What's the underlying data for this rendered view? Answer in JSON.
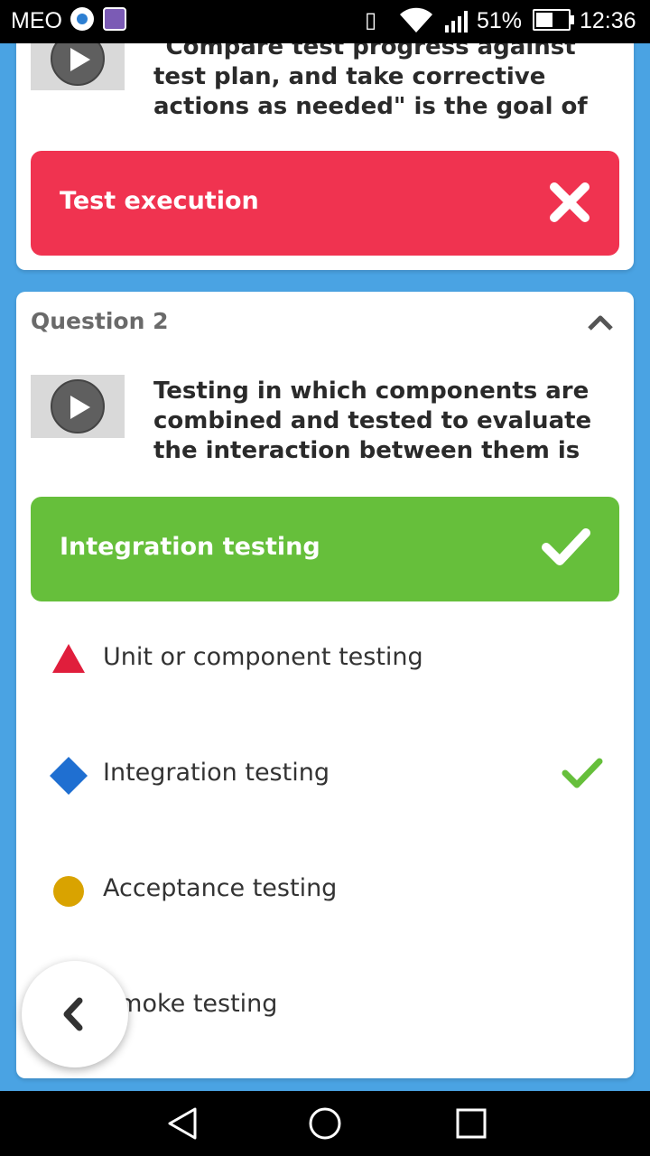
{
  "status_bar": {
    "carrier": "MEO",
    "battery_percent": "51%",
    "time": "12:36"
  },
  "question1": {
    "text": "\"Compare test progress against test plan, and take corrective actions as needed\" is the goal of",
    "user_answer": "Test execution",
    "result": "wrong",
    "colors": {
      "wrong": "#f03350"
    }
  },
  "question2": {
    "heading": "Question 2",
    "text": "Testing in which components are combined and tested to evaluate the interaction between them is",
    "user_answer": "Integration testing",
    "result": "correct",
    "options": [
      {
        "label": "Unit or component testing",
        "shape": "triangle",
        "color": "#e01e3c",
        "correct": false
      },
      {
        "label": "Integration testing",
        "shape": "diamond",
        "color": "#1f6fd1",
        "correct": true
      },
      {
        "label": "Acceptance testing",
        "shape": "circle",
        "color": "#d9a300",
        "correct": false
      },
      {
        "label": "Smoke testing",
        "shape": "square",
        "color": "#2e9e3f",
        "correct": false
      }
    ],
    "colors": {
      "correct": "#66bf3b"
    }
  },
  "icons": {
    "play": "play-icon",
    "wrong": "x-icon",
    "right": "check-icon",
    "collapse": "chevron-up-icon",
    "back": "chevron-left-icon"
  }
}
